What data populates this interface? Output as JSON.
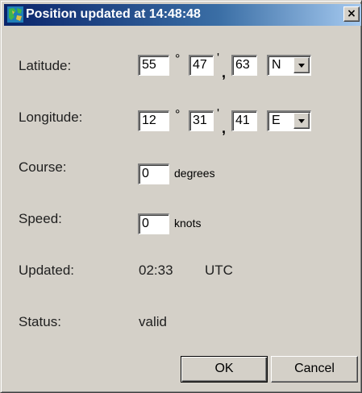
{
  "window": {
    "title": "Position updated at 14:48:48",
    "close_label": "×",
    "title_icon": "map-globe-icon"
  },
  "latitude": {
    "label": "Latitude:",
    "degrees": "55",
    "minutes": "47",
    "seconds": "63",
    "degree_symbol": "°",
    "minute_symbol": "'",
    "separator": ",",
    "hemisphere": "N"
  },
  "longitude": {
    "label": "Longitude:",
    "degrees": "12",
    "minutes": "31",
    "seconds": "41",
    "degree_symbol": "°",
    "minute_symbol": "'",
    "separator": ",",
    "hemisphere": "E"
  },
  "course": {
    "label": "Course:",
    "value": "0",
    "unit": "degrees"
  },
  "speed": {
    "label": "Speed:",
    "value": "0",
    "unit": "knots"
  },
  "updated": {
    "label": "Updated:",
    "time": "02:33",
    "zone": "UTC"
  },
  "status": {
    "label": "Status:",
    "value": "valid"
  },
  "buttons": {
    "ok": "OK",
    "cancel": "Cancel"
  },
  "colors": {
    "title_gradient_start": "#0a246a",
    "title_gradient_end": "#a6caf0",
    "dialog_face": "#d4d0c8"
  }
}
